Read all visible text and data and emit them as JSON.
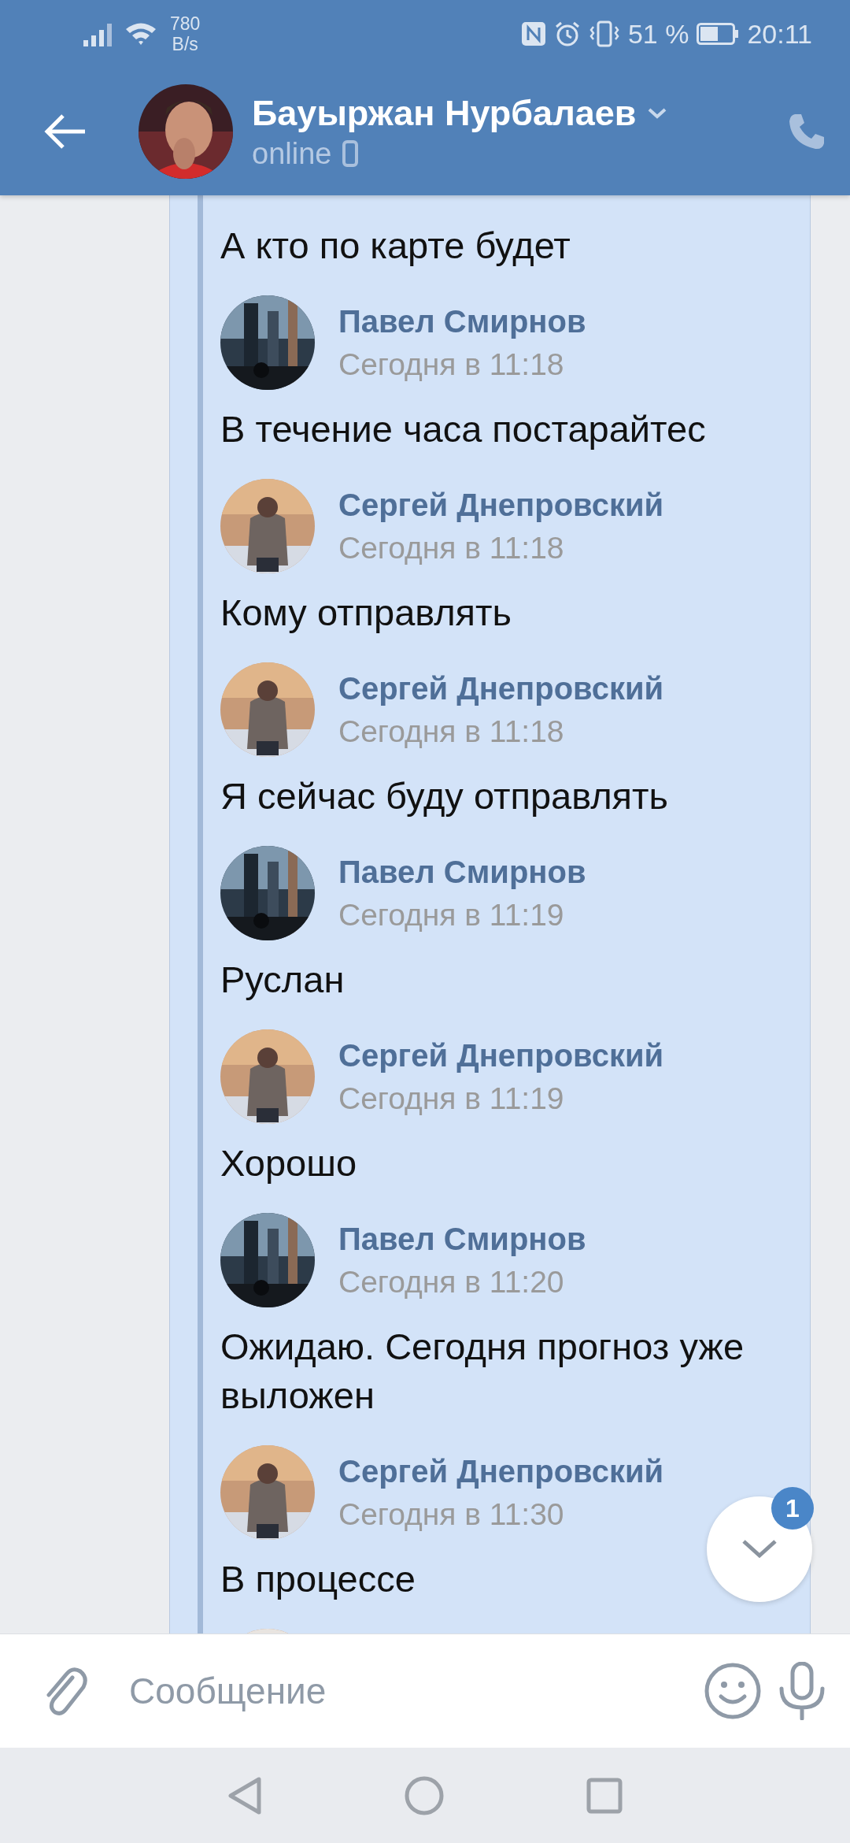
{
  "status_bar": {
    "speed_value": "780",
    "speed_unit": "B/s",
    "battery": "51 %",
    "time": "20:11"
  },
  "header": {
    "name": "Бауыржан Нурбалаев",
    "status": "online"
  },
  "messages": [
    {
      "text": "А кто по карте будет"
    },
    {
      "author": "Павел Смирнов",
      "time": "Сегодня в 11:18",
      "text": "В течение часа постарайтес"
    },
    {
      "author": "Сергей Днепровский",
      "time": "Сегодня в 11:18",
      "text": "Кому отправлять"
    },
    {
      "author": "Сергей Днепровский",
      "time": "Сегодня в 11:18",
      "text": "Я сейчас буду отправлять"
    },
    {
      "author": "Павел Смирнов",
      "time": "Сегодня в 11:19",
      "text": "Руслан"
    },
    {
      "author": "Сергей Днепровский",
      "time": "Сегодня в 11:19",
      "text": "Хорошо"
    },
    {
      "author": "Павел Смирнов",
      "time": "Сегодня в 11:20",
      "text": "Ожидаю. Сегодня прогноз уже выложен"
    },
    {
      "author": "Сергей Днепровский",
      "time": "Сегодня в 11:30",
      "text": "В процессе"
    }
  ],
  "scroll_down": {
    "badge": "1"
  },
  "composer": {
    "placeholder": "Сообщение"
  }
}
